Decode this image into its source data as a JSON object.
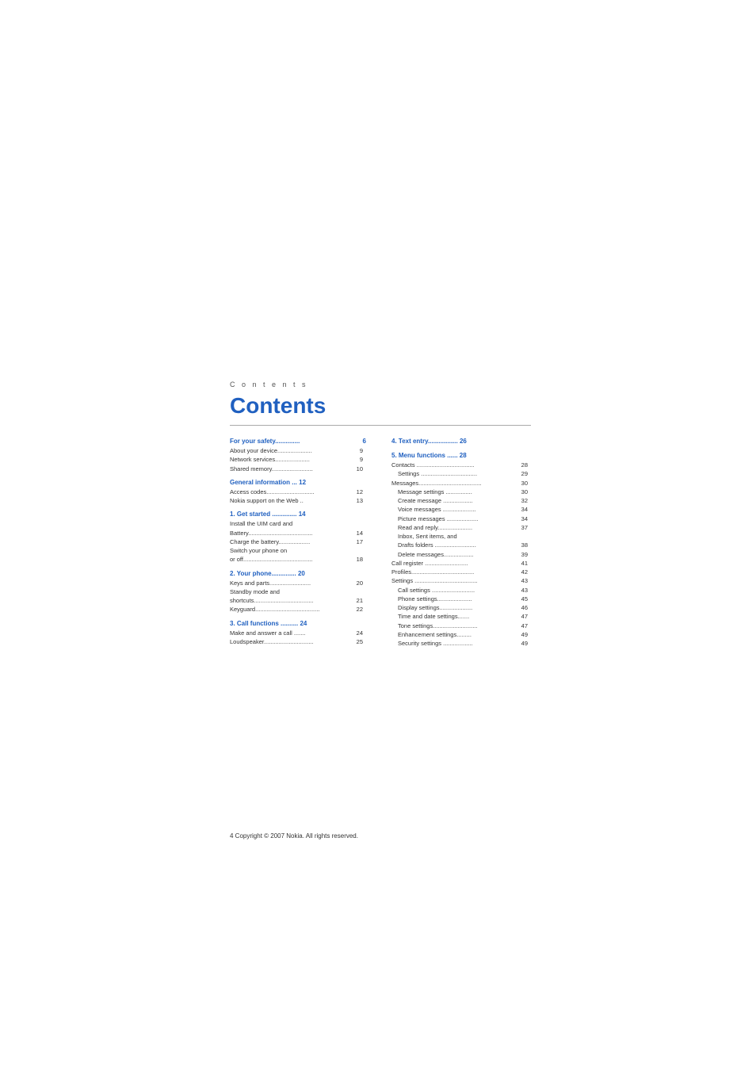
{
  "page": {
    "label": "C o n t e n t s",
    "title": "Contents",
    "footer": "4   Copyright © 2007 Nokia. All rights reserved."
  },
  "left_column": [
    {
      "type": "section",
      "text": "For your safety.............. 6",
      "header": true,
      "header_label": "For your safety..............",
      "header_page": "6",
      "items": [
        {
          "label": "About your device.....................",
          "page": "9"
        },
        {
          "label": "Network services...................",
          "page": "9"
        },
        {
          "label": "Shared memory.......................",
          "page": "10"
        }
      ]
    },
    {
      "type": "section",
      "header": true,
      "header_label": "General information ... 12",
      "header_page": "",
      "items": [
        {
          "label": "Access codes..........................",
          "page": "12"
        },
        {
          "label": "Nokia support on the Web ..",
          "page": "13"
        }
      ]
    },
    {
      "type": "section",
      "header": true,
      "header_label": "1. Get started .............. 14",
      "header_page": "",
      "items": [
        {
          "label": "Install the UIM card and",
          "page": ""
        },
        {
          "label": "Battery......................................",
          "page": "14"
        },
        {
          "label": "Charge the battery..................",
          "page": "17"
        },
        {
          "label": "Switch your phone on",
          "page": ""
        },
        {
          "label": "or off.........................................",
          "page": "18"
        }
      ]
    },
    {
      "type": "section",
      "header": true,
      "header_label": "2. Your phone.............. 20",
      "header_page": "",
      "items": [
        {
          "label": "Keys and parts......................",
          "page": "20"
        },
        {
          "label": "Standby mode and",
          "page": ""
        },
        {
          "label": "shortcuts.................................",
          "page": "21"
        },
        {
          "label": "Keyguard..................................",
          "page": "22"
        }
      ]
    },
    {
      "type": "section",
      "header": true,
      "header_label": "3. Call functions .......... 24",
      "header_page": "",
      "items": [
        {
          "label": "Make and answer a call .....",
          "page": "24"
        },
        {
          "label": "Loudspeaker............................",
          "page": "25"
        }
      ]
    }
  ],
  "right_column": [
    {
      "type": "section",
      "header": true,
      "header_label": "4. Text entry................. 26",
      "header_page": ""
    },
    {
      "type": "section",
      "header": true,
      "header_label": "5. Menu functions ...... 28",
      "header_page": "",
      "items": [
        {
          "label": "Contacts ......................................",
          "page": "28"
        },
        {
          "label": "Settings ...................................",
          "page": "29",
          "indent": true
        },
        {
          "label": "Messages....................................",
          "page": "30"
        },
        {
          "label": "Message settings .................",
          "page": "30",
          "indent": true
        },
        {
          "label": "Create message ...................",
          "page": "32",
          "indent": true
        },
        {
          "label": "Voice messages ....................",
          "page": "34",
          "indent": true
        },
        {
          "label": "Picture messages ..................",
          "page": "34",
          "indent": true
        },
        {
          "label": "Read and reply......................",
          "page": "37",
          "indent": true
        },
        {
          "label": "Inbox, Sent items, and",
          "page": "",
          "indent": true
        },
        {
          "label": "Drafts folders ........................",
          "page": "38",
          "indent": true
        },
        {
          "label": "Delete messages...................",
          "page": "39",
          "indent": true
        },
        {
          "label": "Call register ..........................",
          "page": "41"
        },
        {
          "label": "Profiles....................................",
          "page": "42"
        },
        {
          "label": "Settings ....................................",
          "page": "43"
        },
        {
          "label": "Call settings ..........................",
          "page": "43",
          "indent": true
        },
        {
          "label": "Phone settings......................",
          "page": "45",
          "indent": true
        },
        {
          "label": "Display settings.....................",
          "page": "46",
          "indent": true
        },
        {
          "label": "Time and date settings.......",
          "page": "47",
          "indent": true
        },
        {
          "label": "Tone settings.........................",
          "page": "47",
          "indent": true
        },
        {
          "label": "Enhancement settings.........",
          "page": "49",
          "indent": true
        },
        {
          "label": "Security settings ...................",
          "page": "49",
          "indent": true
        }
      ]
    }
  ]
}
